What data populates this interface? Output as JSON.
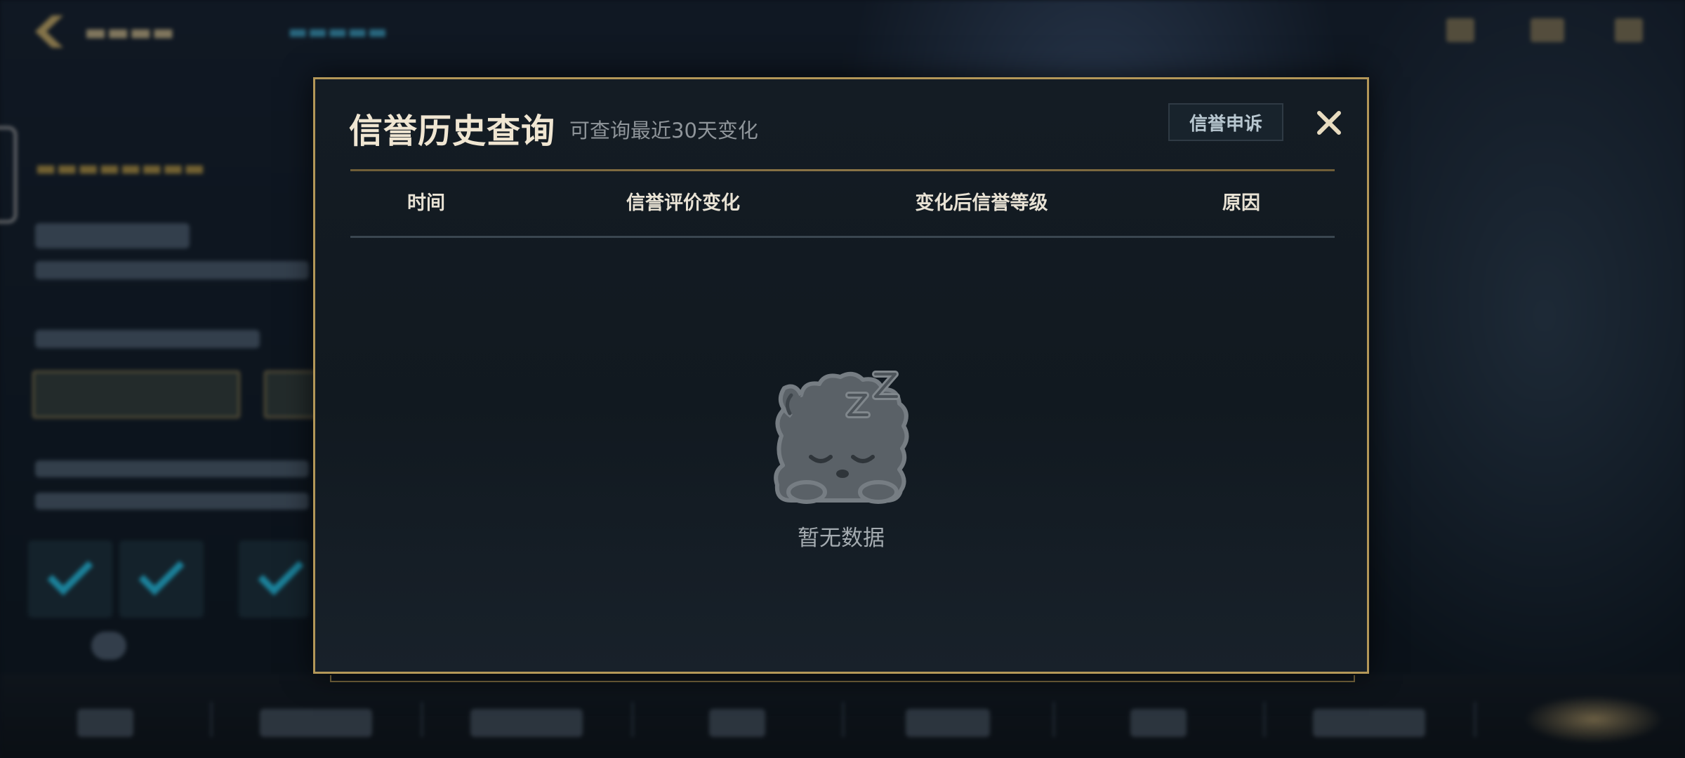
{
  "modal": {
    "title": "信誉历史查询",
    "subtitle": "可查询最近30天变化",
    "appeal_button": "信誉申诉",
    "close_icon": "close-icon",
    "table": {
      "columns": [
        "时间",
        "信誉评价变化",
        "变化后信誉等级",
        "原因"
      ],
      "rows": []
    },
    "empty_state": {
      "icon": "sleeping-mascot-icon",
      "text": "暂无数据"
    }
  },
  "colors": {
    "border_gold": "#b39758",
    "title": "#f0e6d2",
    "subtitle": "#8f959a",
    "background": "#111920"
  }
}
